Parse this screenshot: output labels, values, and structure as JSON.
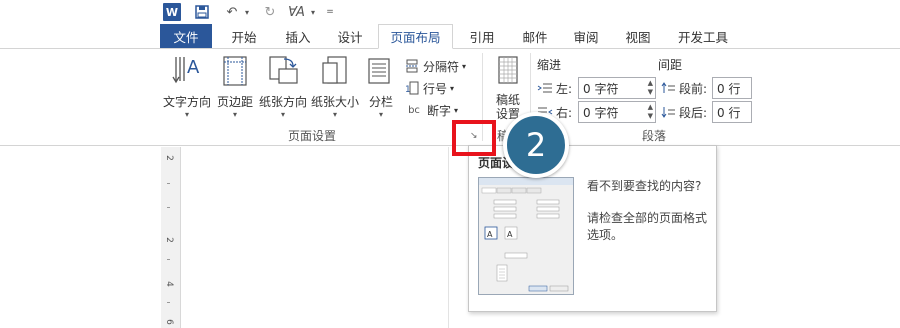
{
  "app": {
    "logo_letter": "W",
    "brand_color": "#2b579a",
    "accent_red": "#e8131c",
    "badge_color": "#2e6d93"
  },
  "qat": {
    "save_icon": "save-icon",
    "undo_icon": "undo-icon",
    "redo_icon": "redo-icon",
    "format_icon": "font-format-icon"
  },
  "tabs": [
    {
      "label": "文件"
    },
    {
      "label": "开始"
    },
    {
      "label": "插入"
    },
    {
      "label": "设计"
    },
    {
      "label": "页面布局"
    },
    {
      "label": "引用"
    },
    {
      "label": "邮件"
    },
    {
      "label": "审阅"
    },
    {
      "label": "视图"
    },
    {
      "label": "开发工具"
    }
  ],
  "page_setup": {
    "text_direction": "文字方向",
    "margins": "页边距",
    "orientation": "纸张方向",
    "size": "纸张大小",
    "columns": "分栏",
    "breaks": "分隔符",
    "line_numbers": "行号",
    "hyphenation": "断字",
    "hyphen_icon_text": "bc",
    "group_label": "页面设置",
    "dropdown_arrow": "▾"
  },
  "draft_paper": {
    "label_line1": "稿纸",
    "label_line2": "设置",
    "group_label_partial": "稿"
  },
  "paragraph": {
    "indent_title": "缩进",
    "spacing_title": "间距",
    "left_label": "左:",
    "right_label": "右:",
    "left_value": "0 字符",
    "right_value": "0 字符",
    "before_label": "段前:",
    "after_label": "段后:",
    "before_value": "0 行",
    "after_value": "0 行",
    "group_label": "段落"
  },
  "ruler": {
    "marks": [
      "2",
      "2",
      "4",
      "6"
    ]
  },
  "callout": {
    "number": "2"
  },
  "tooltip": {
    "title": "页面设置",
    "line1": "看不到要查找的内容?",
    "line2": "请检查全部的页面格式",
    "line3": "选项。"
  }
}
